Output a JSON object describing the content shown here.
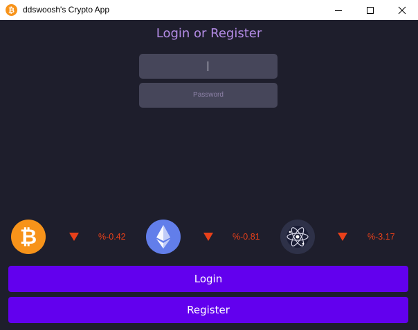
{
  "window": {
    "title": "ddswoosh's Crypto App",
    "icon": "bitcoin-icon"
  },
  "form": {
    "heading": "Login or Register",
    "username_value": "",
    "password_placeholder": "Password"
  },
  "coins": [
    {
      "icon": "bitcoin-icon",
      "trend": "down",
      "change": "%-0.42"
    },
    {
      "icon": "ethereum-icon",
      "trend": "down",
      "change": "%-0.81"
    },
    {
      "icon": "cosmos-atom-icon",
      "trend": "down",
      "change": "%-3.17"
    }
  ],
  "buttons": {
    "login_label": "Login",
    "register_label": "Register"
  },
  "colors": {
    "background": "#1e1e2c",
    "accent": "#6200ee",
    "heading": "#b48ce6",
    "field": "#46465a",
    "negative": "#e8401a",
    "bitcoin": "#f7931a",
    "ethereum": "#627eea"
  }
}
